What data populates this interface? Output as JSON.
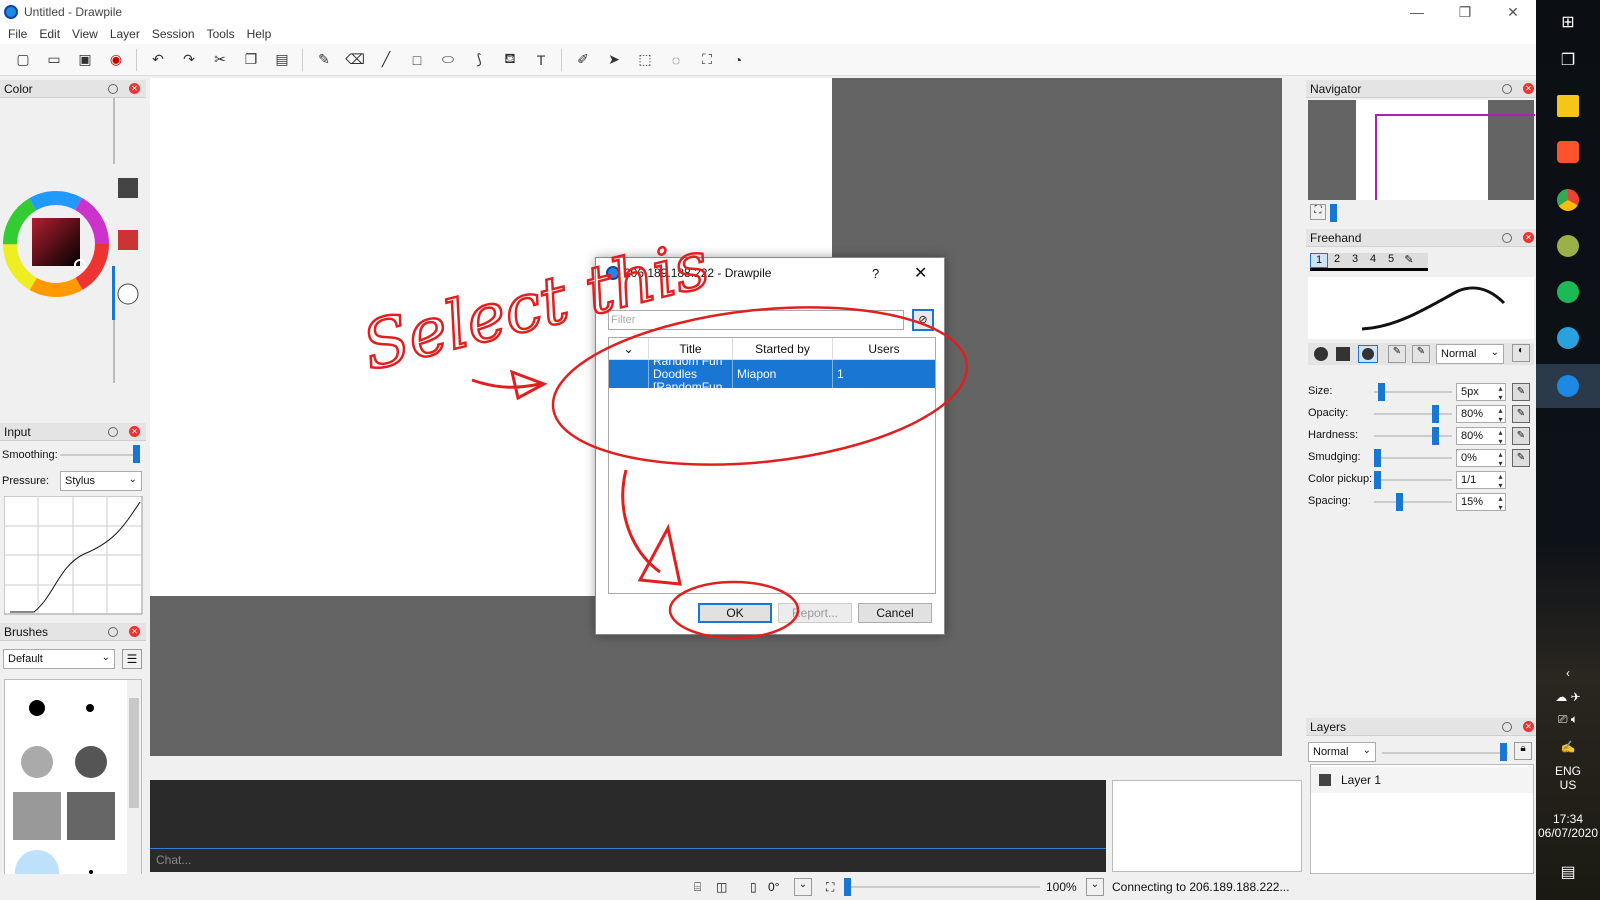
{
  "window": {
    "title": "Untitled - Drawpile"
  },
  "menu": [
    "File",
    "Edit",
    "View",
    "Layer",
    "Session",
    "Tools",
    "Help"
  ],
  "toolbar_icons": [
    "new-icon",
    "open-icon",
    "save-icon",
    "record-icon",
    "undo-icon",
    "redo-icon",
    "cut-icon",
    "copy-icon",
    "paste-icon",
    "brush-icon",
    "eraser-icon",
    "line-icon",
    "rectangle-icon",
    "ellipse-icon",
    "bezier-icon",
    "fill-icon",
    "text-icon",
    "color-picker-icon",
    "laser-icon",
    "select-rect-icon",
    "select-lasso-icon",
    "zoom-select-icon",
    "inspector-icon"
  ],
  "panels": {
    "color": {
      "title": "Color"
    },
    "input": {
      "title": "Input",
      "smoothing_label": "Smoothing:",
      "pressure_label": "Pressure:",
      "pressure_value": "Stylus"
    },
    "brushes": {
      "title": "Brushes",
      "preset": "Default"
    },
    "navigator": {
      "title": "Navigator"
    },
    "freehand": {
      "title": "Freehand",
      "slots": [
        "1",
        "2",
        "3",
        "4",
        "5"
      ],
      "blend_mode": "Normal",
      "settings": [
        {
          "label": "Size:",
          "value": "5px",
          "fraction": 0.06
        },
        {
          "label": "Opacity:",
          "value": "80%",
          "fraction": 0.8
        },
        {
          "label": "Hardness:",
          "value": "80%",
          "fraction": 0.8
        },
        {
          "label": "Smudging:",
          "value": "0%",
          "fraction": 0.0
        },
        {
          "label": "Color pickup:",
          "value": "1/1",
          "fraction": 0.0
        },
        {
          "label": "Spacing:",
          "value": "15%",
          "fraction": 0.3
        }
      ]
    },
    "layers": {
      "title": "Layers",
      "blend_mode": "Normal",
      "items": [
        "Layer 1"
      ]
    }
  },
  "chat": {
    "placeholder": "Chat..."
  },
  "status": {
    "rotation": "0°",
    "zoom": "100%",
    "message": "Connecting to 206.189.188.222..."
  },
  "dialog": {
    "title": "206.189.188.222 - Drawpile",
    "help": "?",
    "filter_placeholder": "Filter",
    "columns": [
      "Title",
      "Started by",
      "Users"
    ],
    "rows": [
      {
        "title": "Random Fun Doodles [RandomFun",
        "started_by": "Miapon",
        "users": "1"
      }
    ],
    "buttons": {
      "ok": "OK",
      "report": "Report...",
      "cancel": "Cancel"
    }
  },
  "annotation": {
    "text": "Select this",
    "color": "#e02020"
  },
  "taskbar": {
    "apps": [
      "windows-start-icon",
      "task-view-icon",
      "file-explorer-icon",
      "brave-icon",
      "chrome-icon",
      "app-globe-icon",
      "spotify-icon",
      "telegram-icon",
      "drawpile-icon"
    ],
    "lang": "ENG",
    "region": "US",
    "time": "17:34",
    "date": "06/07/2020"
  }
}
